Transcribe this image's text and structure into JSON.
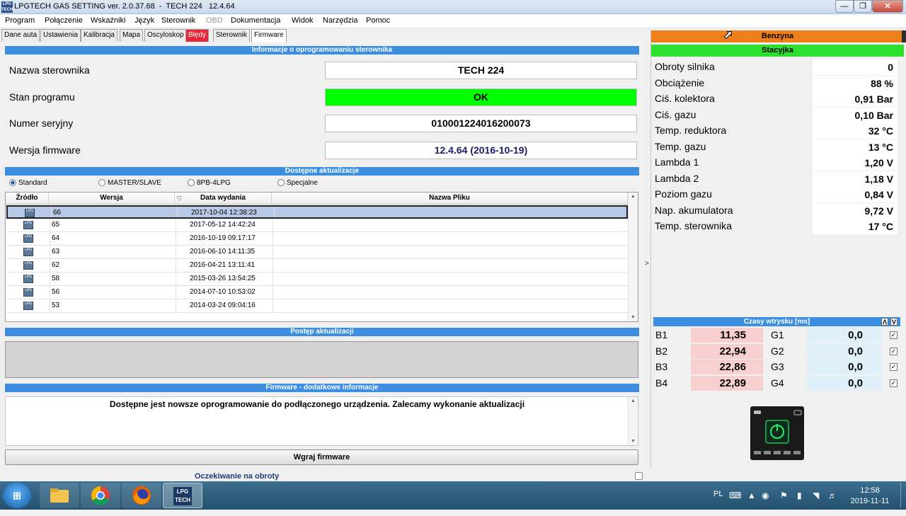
{
  "window": {
    "title": "LPGTECH GAS SETTING ver. 2.0.37.68  -  TECH 224   12.4.64",
    "app_icon_text": "LPG TECH",
    "minimize_icon": "minimize-icon",
    "maximize_icon": "maximize-icon",
    "close_icon": "close-icon"
  },
  "menu": [
    "Program",
    "Połączenie",
    "Wskaźniki",
    "Język",
    "Sterownik",
    "OBD",
    "Dokumentacja",
    "Widok",
    "Narzędzia",
    "Pomoc"
  ],
  "menu_disabled": [
    "OBD"
  ],
  "tabs": [
    "Dane auta",
    "Ustawienia",
    "Kalibracja",
    "Mapa",
    "Oscyloskop",
    "Błędy",
    "Sterownik",
    "Firmware"
  ],
  "active_tab": "Firmware",
  "error_tab": "Błędy",
  "colors": {
    "accent": "#3c8fe0",
    "ok_green": "#00ff00",
    "benzyna_orange": "#ef7f1a",
    "stacyjka_green": "#2ee02e",
    "error_red": "#e8263a"
  },
  "controller_info": {
    "header": "Informacje o oprogramowaniu sterownika",
    "name_label": "Nazwa sterownika",
    "name_value": "TECH 224",
    "status_label": "Stan programu",
    "status_value": "OK",
    "serial_label": "Numer seryjny",
    "serial_value": "010001224016200073",
    "firmware_label": "Wersja firmware",
    "firmware_value": "12.4.64  (2016-10-19)"
  },
  "updates": {
    "header": "Dostępne aktualizacje",
    "options": [
      "Standard",
      "MASTER/SLAVE",
      "8PB-4LPG",
      "Specjalne"
    ],
    "selected_option": "Standard",
    "columns": [
      "Źródło",
      "Wersja",
      "Data wydania",
      "Nazwa Pliku"
    ],
    "rows": [
      {
        "version": "66",
        "date": "2017-10-04 12:38:23",
        "file": ""
      },
      {
        "version": "65",
        "date": "2017-05-12 14:42:24",
        "file": ""
      },
      {
        "version": "64",
        "date": "2016-10-19 09:17:17",
        "file": ""
      },
      {
        "version": "63",
        "date": "2016-06-10 14:11:35",
        "file": ""
      },
      {
        "version": "62",
        "date": "2016-04-21 13:11:41",
        "file": ""
      },
      {
        "version": "58",
        "date": "2015-03-26 13:54:25",
        "file": ""
      },
      {
        "version": "56",
        "date": "2014-07-10 10:53:02",
        "file": ""
      },
      {
        "version": "53",
        "date": "2014-03-24 09:04:16",
        "file": ""
      }
    ],
    "selected_row": 0,
    "source_icon": "lpg-sequential-icon"
  },
  "progress": {
    "header": "Postęp aktualizacji",
    "value": 0
  },
  "extra": {
    "header": "Firmware - dodatkowe informacje",
    "text": "Dostępne jest nowsze oprogramowanie do podłączonego urządzenia. Zalecamy wykonanie aktualizacji"
  },
  "flash_button": "Wgraj firmware",
  "status_bar": "Oczekiwanie na obroty",
  "fuel_mode": "Benzyna",
  "ignition": "Stacyjka",
  "params": [
    {
      "label": "Obroty silnika",
      "value": "0"
    },
    {
      "label": "Obciążenie",
      "value": "88 %"
    },
    {
      "label": "Ciś. kolektora",
      "value": "0,91 Bar"
    },
    {
      "label": "Ciś. gazu",
      "value": "0,10 Bar"
    },
    {
      "label": "Temp. reduktora",
      "value": "32 °C"
    },
    {
      "label": "Temp. gazu",
      "value": "13 °C"
    },
    {
      "label": "Lambda 1",
      "value": "1,20 V"
    },
    {
      "label": "Lambda 2",
      "value": "1,18 V"
    },
    {
      "label": "Poziom gazu",
      "value": "0,84 V"
    },
    {
      "label": "Nap. akumulatora",
      "value": "9,72 V"
    },
    {
      "label": "Temp. sterownika",
      "value": "17 °C"
    }
  ],
  "injection": {
    "header": "Czasy wtrysku [ms]",
    "rows": [
      {
        "b_label": "B1",
        "b_value": "11,35",
        "g_label": "G1",
        "g_value": "0,0",
        "checked": true
      },
      {
        "b_label": "B2",
        "b_value": "22,94",
        "g_label": "G2",
        "g_value": "0,0",
        "checked": true
      },
      {
        "b_label": "B3",
        "b_value": "22,86",
        "g_label": "G3",
        "g_value": "0,0",
        "checked": true
      },
      {
        "b_label": "B4",
        "b_value": "22,89",
        "g_label": "G4",
        "g_value": "0,0",
        "checked": true
      }
    ]
  },
  "switch_icon": "power-switch-icon",
  "taskbar": {
    "start_icon": "windows-start-icon",
    "items": [
      {
        "name": "explorer",
        "icon": "folder-icon"
      },
      {
        "name": "chrome",
        "icon": "chrome-icon"
      },
      {
        "name": "firefox",
        "icon": "firefox-icon"
      },
      {
        "name": "lpgtech",
        "icon": "lpgtech-icon",
        "text": "LPG TECH"
      }
    ],
    "lang": "PL",
    "time": "12:58",
    "date": "2019-11-11"
  }
}
